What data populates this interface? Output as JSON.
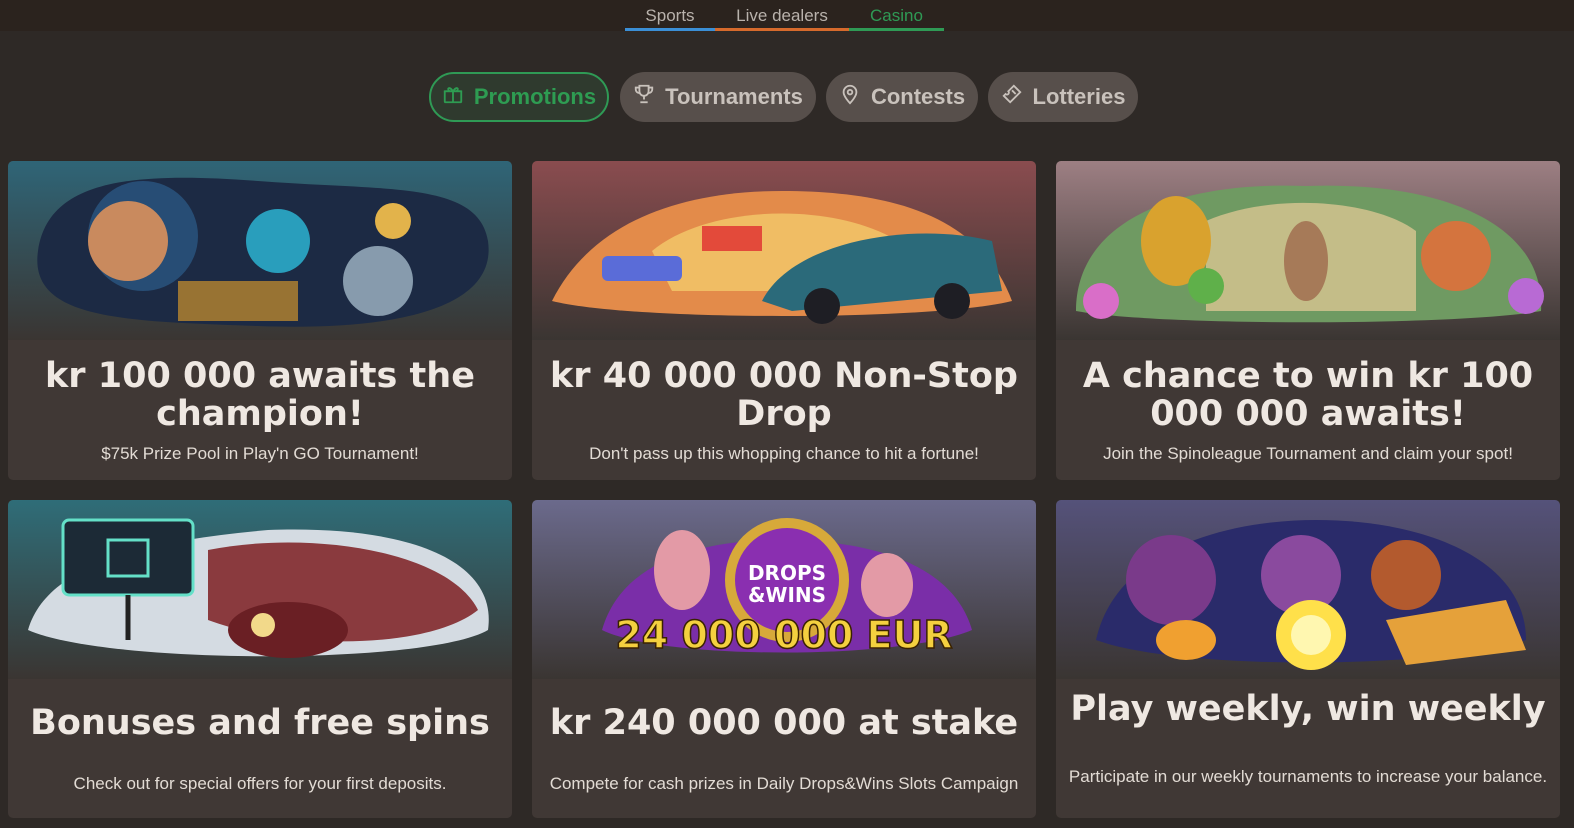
{
  "top_nav": {
    "sports": "Sports",
    "live": "Live dealers",
    "casino": "Casino",
    "colors": {
      "sports": "#3b8fd6",
      "live": "#d66a2c",
      "casino": "#2f9a55"
    }
  },
  "filters": {
    "promotions": "Promotions",
    "tournaments": "Tournaments",
    "contests": "Contests",
    "lotteries": "Lotteries",
    "active_color": "#2f9a55"
  },
  "cards": [
    {
      "title": "kr 100 000 awaits the champion!",
      "subtitle": "$75k Prize Pool in Play'n GO Tournament!"
    },
    {
      "title": "kr 40 000 000 Non-Stop Drop",
      "subtitle": "Don't pass up this whopping chance to hit a fortune!"
    },
    {
      "title": "A chance to win kr 100 000 000 awaits!",
      "subtitle": "Join the Spinoleague Tournament and claim your spot!"
    },
    {
      "title": "Bonuses and free spins",
      "subtitle": "Check out for special offers for your first deposits."
    },
    {
      "title": "kr 240 000 000 at stake",
      "subtitle": "Compete for cash prizes in Daily Drops&Wins Slots Campaign"
    },
    {
      "title": "Play weekly, win weekly",
      "subtitle": "Participate in our weekly tournaments to increase your balance."
    }
  ],
  "banner_text": {
    "drops_wins_1": "DROPS",
    "drops_wins_2": "&WINS",
    "amount": "24 000 000 EUR"
  }
}
